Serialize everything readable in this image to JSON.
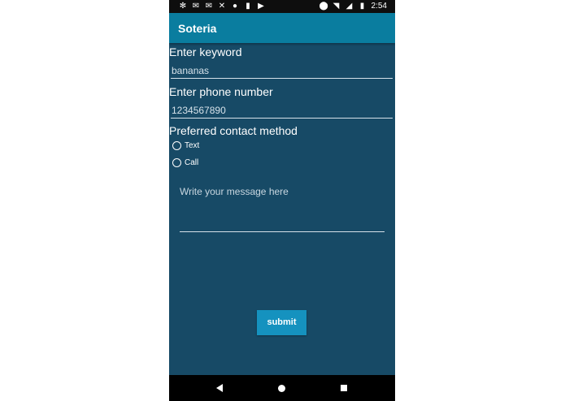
{
  "status_bar": {
    "time": "2:54",
    "left_icons": [
      "gear-icon",
      "gmail-icon",
      "gmail-icon",
      "missed-call-icon",
      "circle-icon",
      "sd-card-icon",
      "play-store-icon"
    ],
    "right_icons": [
      "location-icon",
      "wifi-icon",
      "signal-icon",
      "battery-icon"
    ]
  },
  "app_bar": {
    "title": "Soteria",
    "color": "#0a7d9f"
  },
  "form": {
    "keyword_label": "Enter keyword",
    "keyword_value": "bananas",
    "phone_label": "Enter phone number",
    "phone_value": "1234567890",
    "contact_label": "Preferred contact method",
    "contact_options": [
      {
        "label": "Text",
        "selected": false
      },
      {
        "label": "Call",
        "selected": false
      }
    ],
    "message_placeholder": "Write your message here",
    "submit_label": "submit"
  },
  "colors": {
    "background": "#174a66",
    "button": "#1592bf"
  }
}
